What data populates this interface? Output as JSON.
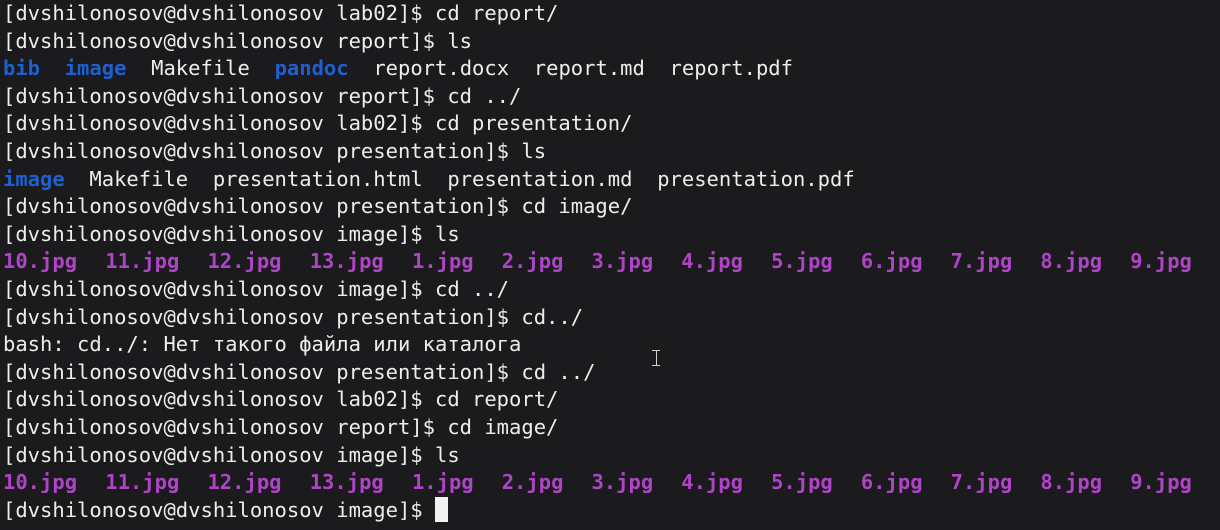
{
  "terminal": {
    "lines": [
      "[dvshilonosov@dvshilonosov lab02]$ cd report/",
      "[dvshilonosov@dvshilonosov report]$ ls",
      "",
      "[dvshilonosov@dvshilonosov report]$ cd ../",
      "[dvshilonosov@dvshilonosov lab02]$ cd presentation/",
      "[dvshilonosov@dvshilonosov presentation]$ ls",
      "",
      "[dvshilonosov@dvshilonosov presentation]$ cd image/",
      "[dvshilonosov@dvshilonosov image]$ ls",
      "",
      "[dvshilonosov@dvshilonosov image]$ cd ../",
      "[dvshilonosov@dvshilonosov presentation]$ cd../",
      "bash: cd../: Нет такого файла или каталога",
      "[dvshilonosov@dvshilonosov presentation]$ cd ../",
      "[dvshilonosov@dvshilonosov lab02]$ cd report/",
      "[dvshilonosov@dvshilonosov report]$ cd image/",
      "[dvshilonosov@dvshilonosov image]$ ls",
      "",
      "[dvshilonosov@dvshilonosov image]$"
    ],
    "ls_report": [
      {
        "name": "bib",
        "kind": "dir",
        "sep": "  "
      },
      {
        "name": "image",
        "kind": "dir",
        "sep": "  "
      },
      {
        "name": "Makefile",
        "kind": "file",
        "sep": "  "
      },
      {
        "name": "pandoc",
        "kind": "dir",
        "sep": "  "
      },
      {
        "name": "report.docx",
        "kind": "file",
        "sep": "  "
      },
      {
        "name": "report.md",
        "kind": "file",
        "sep": "  "
      },
      {
        "name": "report.pdf",
        "kind": "file",
        "sep": ""
      }
    ],
    "ls_presentation": [
      {
        "name": "image",
        "kind": "dir",
        "sep": "  "
      },
      {
        "name": "Makefile",
        "kind": "file",
        "sep": "  "
      },
      {
        "name": "presentation.html",
        "kind": "file",
        "sep": "  "
      },
      {
        "name": "presentation.md",
        "kind": "file",
        "sep": "  "
      },
      {
        "name": "presentation.pdf",
        "kind": "file",
        "sep": ""
      }
    ],
    "ls_image": [
      "10.jpg",
      "11.jpg",
      "12.jpg",
      "13.jpg",
      "1.jpg",
      "2.jpg",
      "3.jpg",
      "4.jpg",
      "5.jpg",
      "6.jpg",
      "7.jpg",
      "8.jpg",
      "9.jpg"
    ],
    "colors": {
      "background": "#1b1b1e",
      "text": "#ededed",
      "directory": "#1f5fd0",
      "image_file": "#b044c8"
    },
    "icons": {
      "mouse_pointer": "ibeam-cursor-icon",
      "text_cursor": "block-cursor"
    }
  }
}
